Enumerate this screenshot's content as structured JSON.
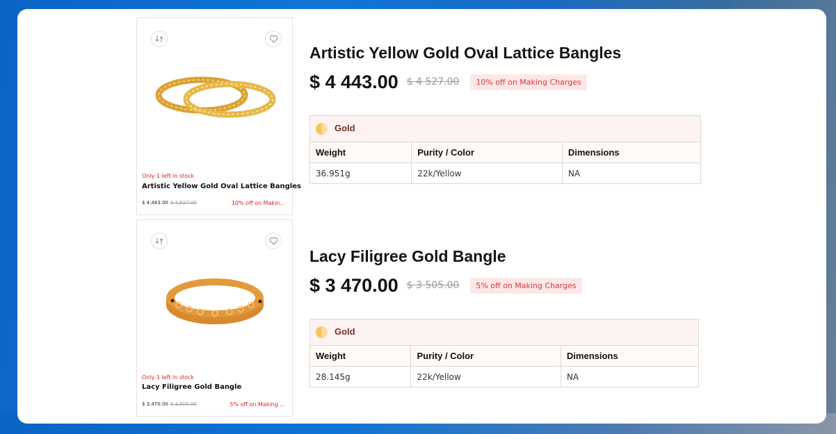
{
  "colors": {
    "accent_red": "#e21b1b",
    "offer_bg": "#fde8e8",
    "gold": "#f6c45a"
  },
  "products": [
    {
      "card": {
        "stock": "Only 1 left in stock",
        "name": "Artistic Yellow Gold Oval Lattice Bangles",
        "price": "$ 4,443.00",
        "old_price": "$ 4,527.00",
        "offer": "10% off on Makin..."
      },
      "detail": {
        "title": "Artistic Yellow Gold Oval Lattice Bangles",
        "price": "$ 4 443.00",
        "old_price": "$ 4 527.00",
        "offer": "10% off on Making Charges",
        "metal": "Gold",
        "headers": [
          "Weight",
          "Purity / Color",
          "Dimensions"
        ],
        "values": [
          "36.951g",
          "22k/Yellow",
          "NA"
        ]
      }
    },
    {
      "card": {
        "stock": "Only 1 left in stock",
        "name": "Lacy Filigree Gold Bangle",
        "price": "$ 3,470.00",
        "old_price": "$ 3,505.00",
        "offer": "5% off on Making ..."
      },
      "detail": {
        "title": "Lacy Filigree Gold Bangle",
        "price": "$ 3 470.00",
        "old_price": "$ 3 505.00",
        "offer": "5% off on Making Charges",
        "metal": "Gold",
        "headers": [
          "Weight",
          "Purity / Color",
          "Dimensions"
        ],
        "values": [
          "28.145g",
          "22k/Yellow",
          "NA"
        ]
      }
    }
  ],
  "icons": [
    "compare-icon",
    "heart-icon",
    "gold-metal-icon"
  ]
}
